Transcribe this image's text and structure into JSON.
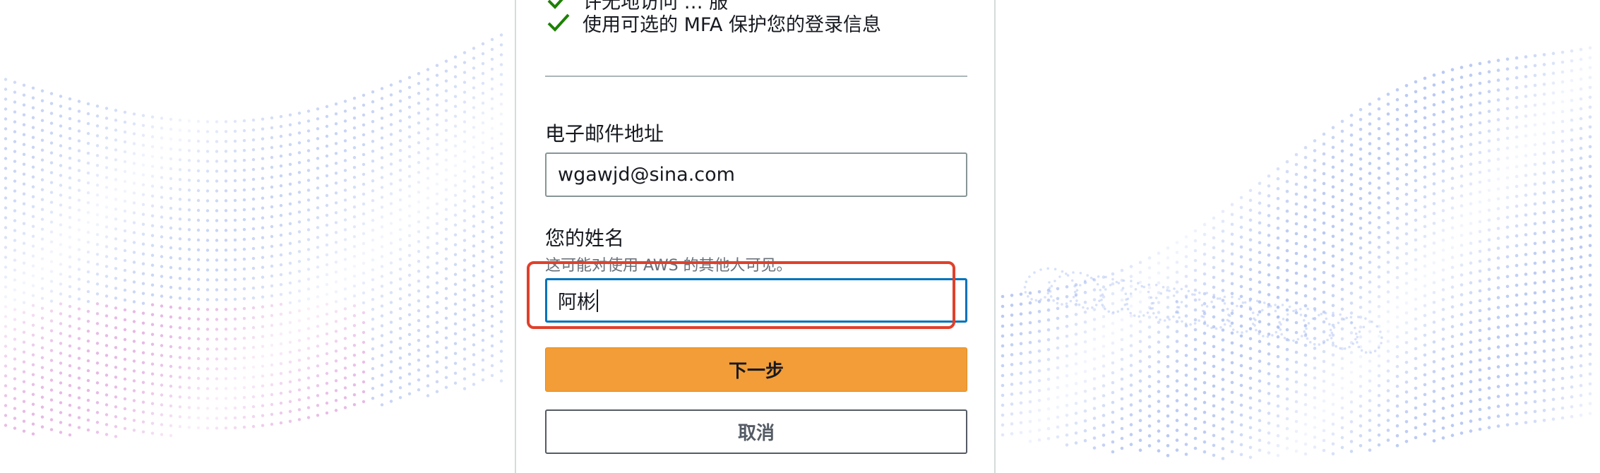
{
  "signup": {
    "benefits": [
      "许无地访问 … 服",
      "使用可选的 MFA 保护您的登录信息"
    ],
    "email": {
      "label": "电子邮件地址",
      "value": "wgawjd@sina.com"
    },
    "name": {
      "label": "您的姓名",
      "hint": "这可能对使用 AWS 的其他人可见。",
      "value": "阿彬"
    },
    "next_button": "下一步",
    "cancel_button": "取消"
  },
  "colors": {
    "primary_button": "#f29d38",
    "focus_border": "#0073bb",
    "check": "#1d8102",
    "annotation": "#e0402a"
  }
}
